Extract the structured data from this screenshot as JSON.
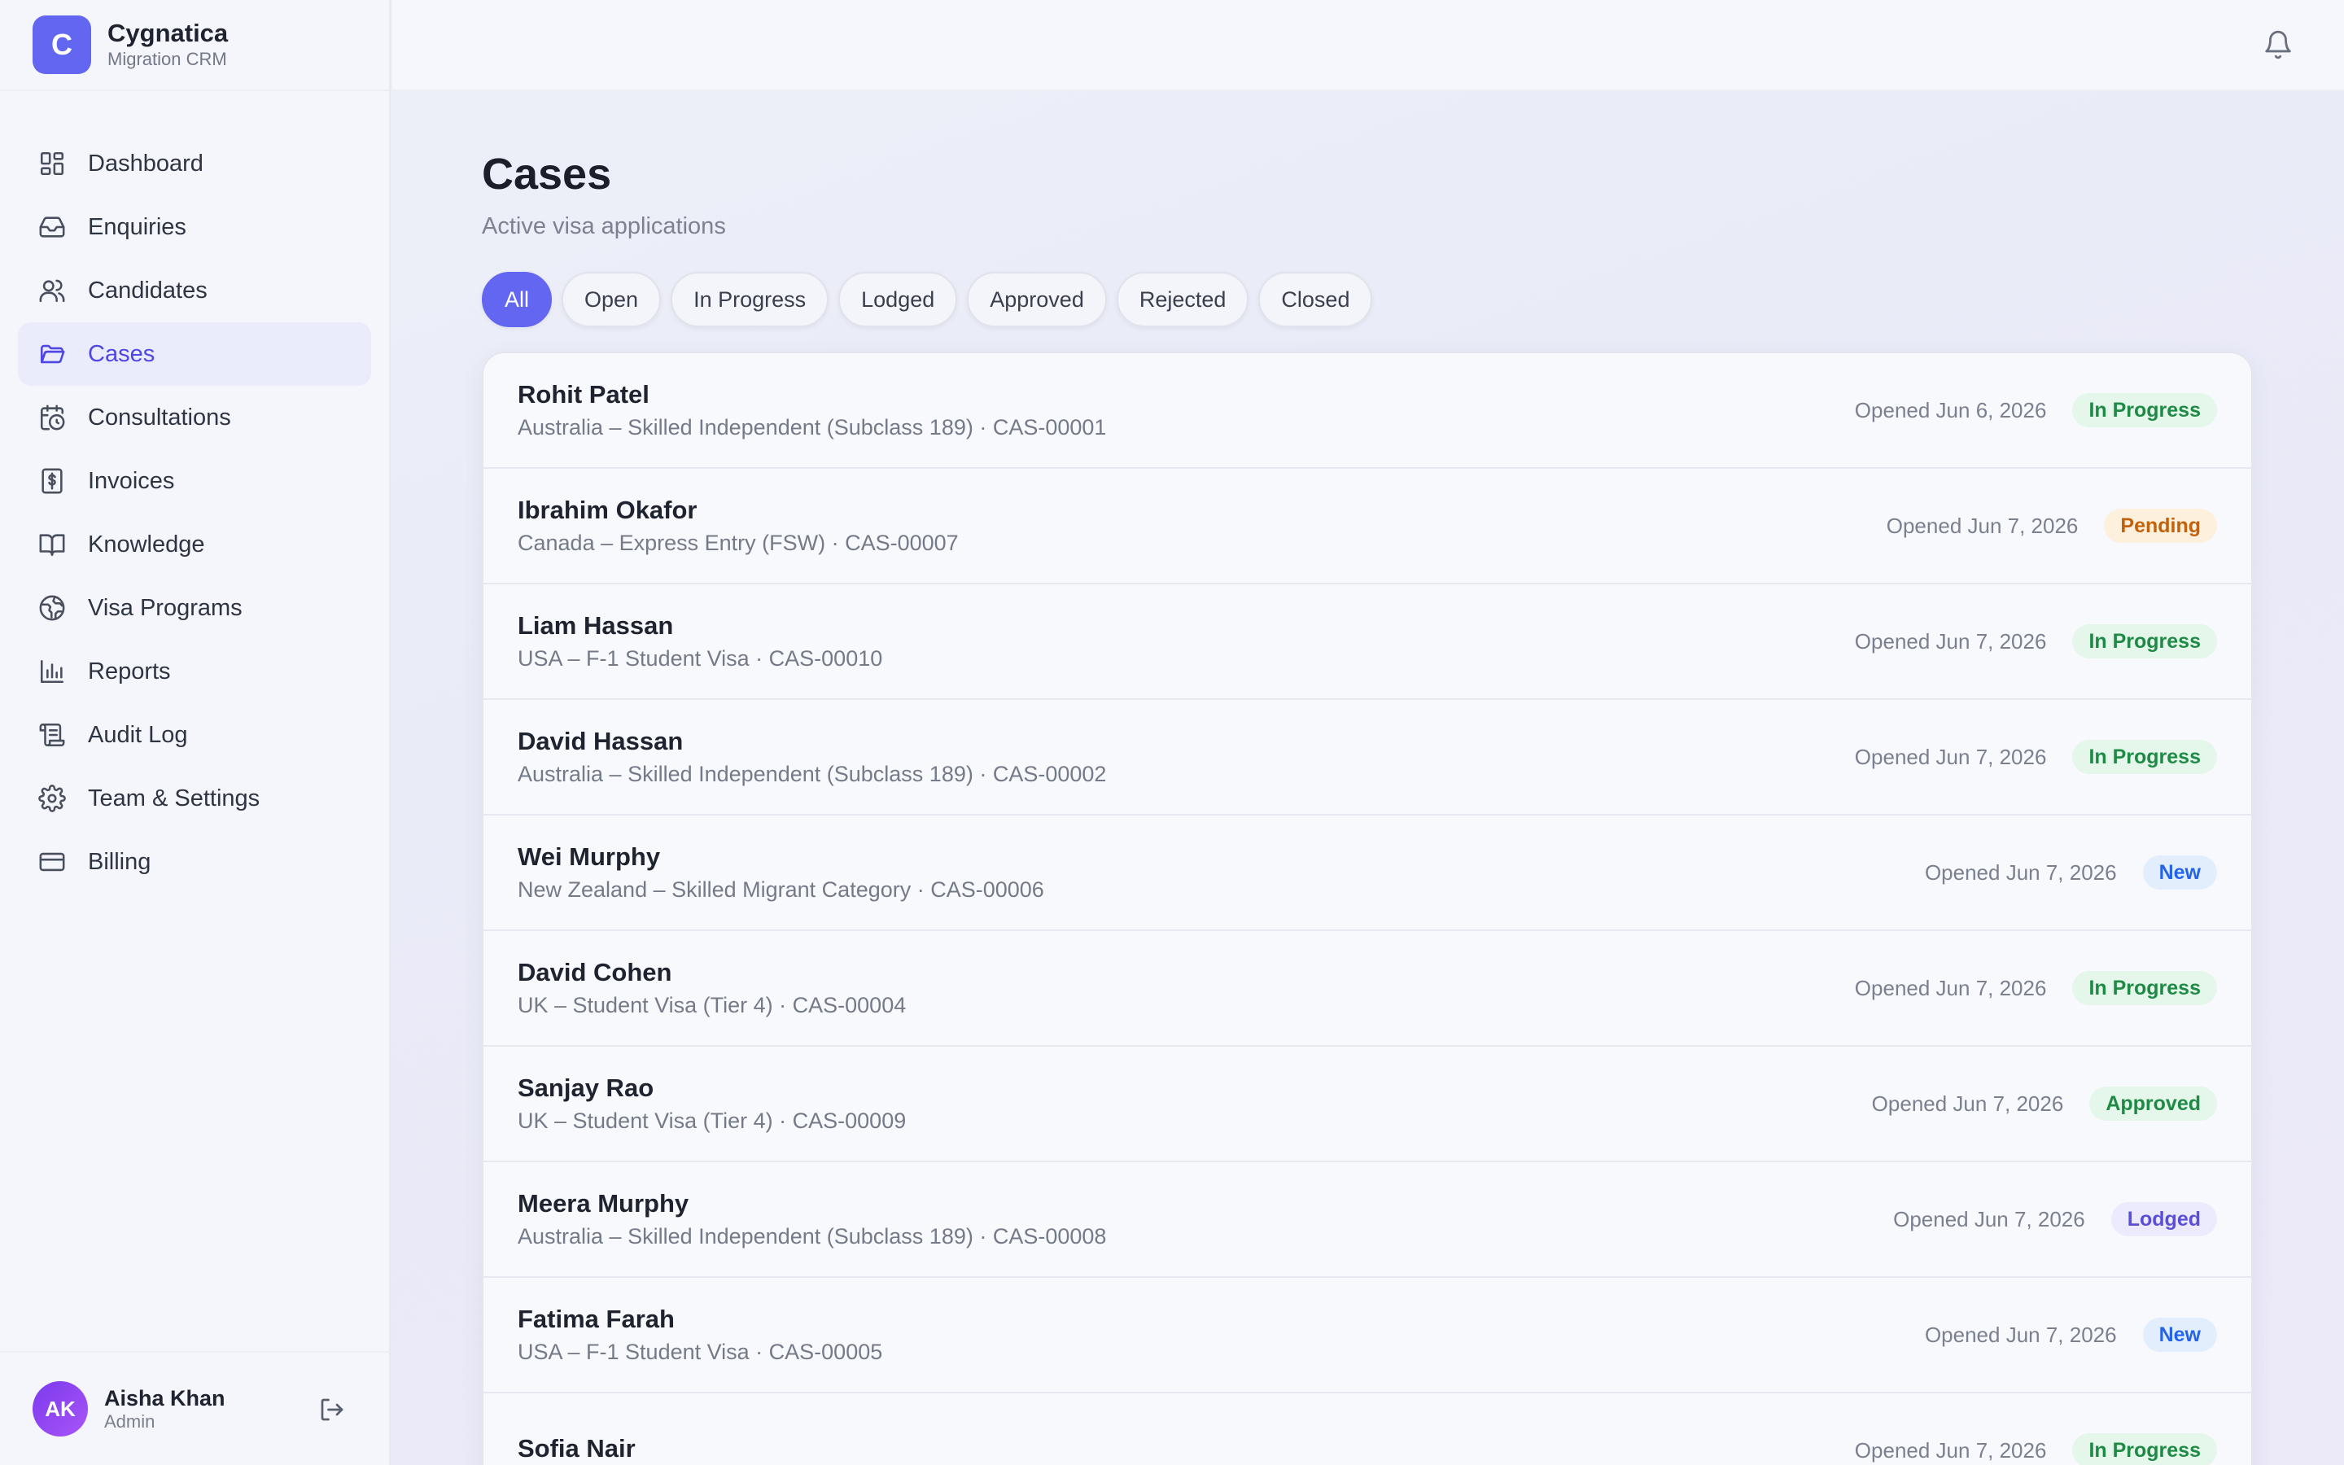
{
  "brand": {
    "logo_letter": "C",
    "title": "Cygnatica",
    "subtitle": "Migration CRM"
  },
  "nav": [
    {
      "label": "Dashboard",
      "icon": "dashboard-icon",
      "active": false
    },
    {
      "label": "Enquiries",
      "icon": "inbox-icon",
      "active": false
    },
    {
      "label": "Candidates",
      "icon": "users-icon",
      "active": false
    },
    {
      "label": "Cases",
      "icon": "folder-icon",
      "active": true
    },
    {
      "label": "Consultations",
      "icon": "calendar-clock-icon",
      "active": false
    },
    {
      "label": "Invoices",
      "icon": "receipt-icon",
      "active": false
    },
    {
      "label": "Knowledge",
      "icon": "book-icon",
      "active": false
    },
    {
      "label": "Visa Programs",
      "icon": "globe-icon",
      "active": false
    },
    {
      "label": "Reports",
      "icon": "bar-chart-icon",
      "active": false
    },
    {
      "label": "Audit Log",
      "icon": "scroll-icon",
      "active": false
    },
    {
      "label": "Team & Settings",
      "icon": "gear-icon",
      "active": false
    },
    {
      "label": "Billing",
      "icon": "credit-card-icon",
      "active": false
    }
  ],
  "user": {
    "initials": "AK",
    "name": "Aisha Khan",
    "role": "Admin"
  },
  "page": {
    "title": "Cases",
    "subtitle": "Active visa applications"
  },
  "filters": [
    "All",
    "Open",
    "In Progress",
    "Lodged",
    "Approved",
    "Rejected",
    "Closed"
  ],
  "active_filter": "All",
  "cases": [
    {
      "name": "Rohit Patel",
      "desc": "Australia – Skilled Independent (Subclass 189) · CAS-00001",
      "date": "Opened Jun 6, 2026",
      "status": "In Progress",
      "kind": "progress"
    },
    {
      "name": "Ibrahim Okafor",
      "desc": "Canada – Express Entry (FSW) · CAS-00007",
      "date": "Opened Jun 7, 2026",
      "status": "Pending",
      "kind": "pending"
    },
    {
      "name": "Liam Hassan",
      "desc": "USA – F-1 Student Visa · CAS-00010",
      "date": "Opened Jun 7, 2026",
      "status": "In Progress",
      "kind": "progress"
    },
    {
      "name": "David Hassan",
      "desc": "Australia – Skilled Independent (Subclass 189) · CAS-00002",
      "date": "Opened Jun 7, 2026",
      "status": "In Progress",
      "kind": "progress"
    },
    {
      "name": "Wei Murphy",
      "desc": "New Zealand – Skilled Migrant Category · CAS-00006",
      "date": "Opened Jun 7, 2026",
      "status": "New",
      "kind": "new"
    },
    {
      "name": "David Cohen",
      "desc": "UK – Student Visa (Tier 4) · CAS-00004",
      "date": "Opened Jun 7, 2026",
      "status": "In Progress",
      "kind": "progress"
    },
    {
      "name": "Sanjay Rao",
      "desc": "UK – Student Visa (Tier 4) · CAS-00009",
      "date": "Opened Jun 7, 2026",
      "status": "Approved",
      "kind": "approved"
    },
    {
      "name": "Meera Murphy",
      "desc": "Australia – Skilled Independent (Subclass 189) · CAS-00008",
      "date": "Opened Jun 7, 2026",
      "status": "Lodged",
      "kind": "lodged"
    },
    {
      "name": "Fatima Farah",
      "desc": "USA – F-1 Student Visa · CAS-00005",
      "date": "Opened Jun 7, 2026",
      "status": "New",
      "kind": "new"
    },
    {
      "name": "Sofia Nair",
      "desc": "",
      "date": "Opened Jun 7, 2026",
      "status": "In Progress",
      "kind": "progress"
    }
  ]
}
